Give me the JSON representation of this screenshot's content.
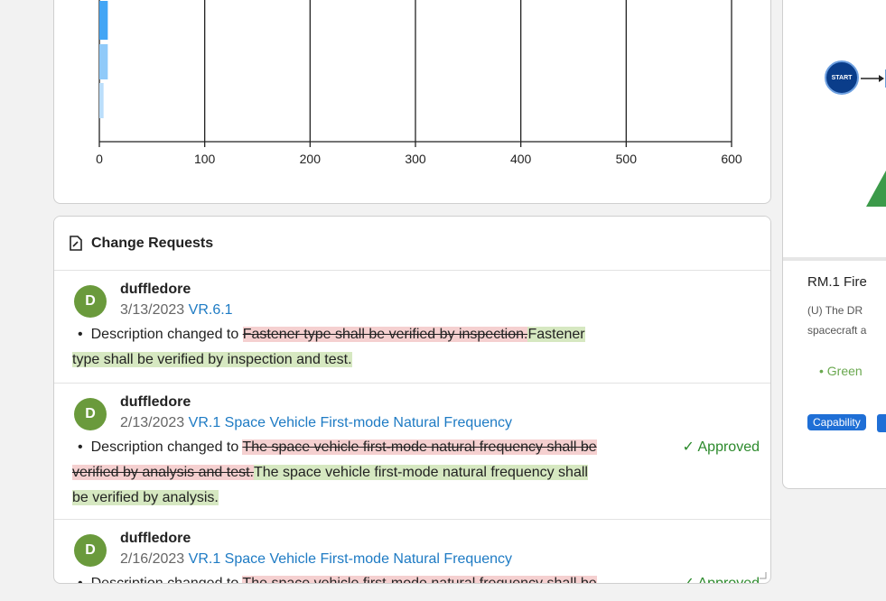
{
  "chart_data": {
    "type": "bar",
    "orientation": "horizontal",
    "x_ticks": [
      "0",
      "100",
      "200",
      "300",
      "400",
      "500",
      "600"
    ],
    "xlim": [
      0,
      600
    ],
    "grid": true,
    "values": [
      8,
      8,
      4
    ],
    "colors": [
      "#42a5f5",
      "#90caf9",
      "#bbdefb"
    ]
  },
  "change_requests": {
    "title": "Change Requests",
    "entries": [
      {
        "avatar": "D",
        "author": "duffledore",
        "date": "3/13/2023",
        "ref": "VR.6.1",
        "prefix": "Description changed to",
        "old": "Fastener type shall be verified by inspection.",
        "new_line1": "Fastener",
        "new_line2": "type shall be verified by inspection and test.",
        "status": ""
      },
      {
        "avatar": "D",
        "author": "duffledore",
        "date": "2/13/2023",
        "ref": "VR.1 Space Vehicle First-mode Natural Frequency",
        "prefix": "Description changed to",
        "old_line1": "The space vehicle first-mode natural frequency shall be",
        "old_line2": "verified by analysis and test.",
        "new_line1": "The space vehicle first-mode natural frequency shall",
        "new_line2": "be verified by analysis.",
        "status": "✓ Approved"
      },
      {
        "avatar": "D",
        "author": "duffledore",
        "date": "2/16/2023",
        "ref": "VR.1 Space Vehicle First-mode Natural Frequency",
        "prefix": "Description changed to",
        "old_line1": "The space vehicle first-mode natural frequency shall be",
        "status": "✓ Approved"
      }
    ]
  },
  "right_panel": {
    "start_label": "START",
    "title": "RM.1 Fire",
    "text_line1": "(U) The DR",
    "text_line2": "spacecraft a",
    "green_item": "Green",
    "badge": "Capability"
  }
}
